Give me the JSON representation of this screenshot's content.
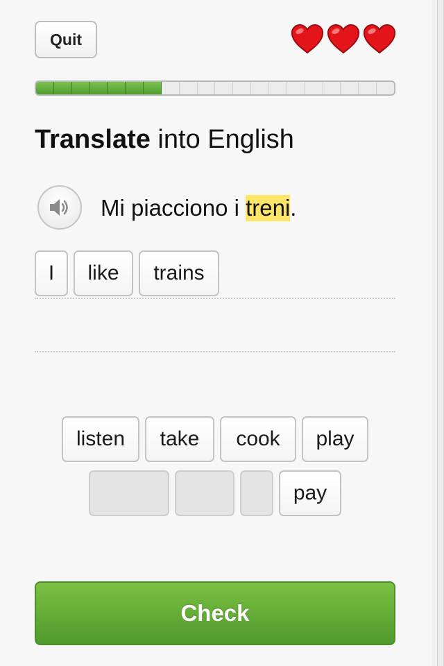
{
  "header": {
    "quit_label": "Quit",
    "lives": 3,
    "hearts": [
      "heart-icon",
      "heart-icon",
      "heart-icon"
    ]
  },
  "progress": {
    "completed": 7,
    "total": 20,
    "fraction": 0.35,
    "color": "#5ca83a"
  },
  "prompt": {
    "instruction_bold": "Translate",
    "instruction_rest": " into English",
    "audio_icon": "speaker-icon",
    "sentence": [
      {
        "text": "Mi piacciono i ",
        "highlight": false
      },
      {
        "text": "treni",
        "highlight": true
      },
      {
        "text": ".",
        "highlight": false
      }
    ],
    "highlight_color": "#fde567"
  },
  "answer": {
    "tiles": [
      "I",
      "like",
      "trains"
    ]
  },
  "word_bank": {
    "row1": [
      "listen",
      "take",
      "cook",
      "play"
    ],
    "row2": [
      {
        "text": "",
        "used": true
      },
      {
        "text": "",
        "used": true
      },
      {
        "text": "",
        "used": true
      },
      {
        "text": "pay",
        "used": false
      }
    ]
  },
  "footer": {
    "check_label": "Check",
    "accent": "#5ca83a"
  }
}
